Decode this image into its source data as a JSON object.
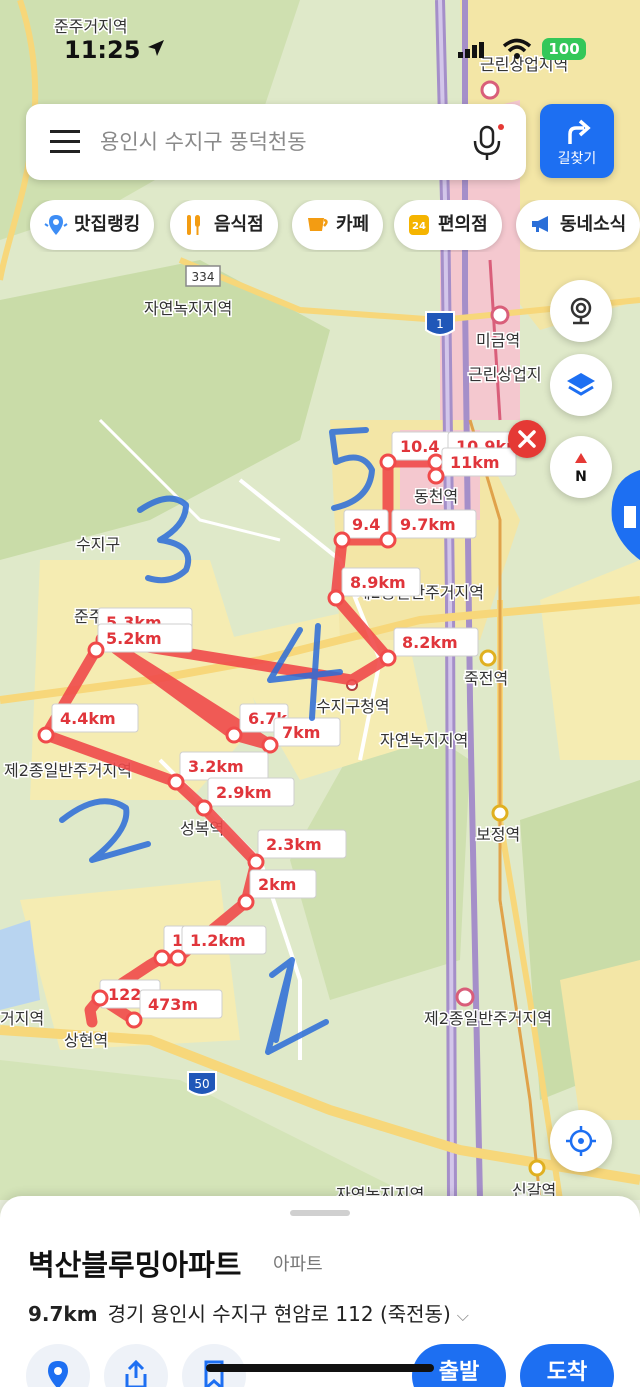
{
  "status_bar": {
    "time": "11:25",
    "battery": "100"
  },
  "search": {
    "placeholder": "용인시 수지구 풍덕천동"
  },
  "directions_button": {
    "label": "길찾기"
  },
  "chips": [
    {
      "label": "맛집랭킹",
      "icon": "ranking-pin-icon"
    },
    {
      "label": "음식점",
      "icon": "fork-knife-icon"
    },
    {
      "label": "카페",
      "icon": "coffee-cup-icon"
    },
    {
      "label": "편의점",
      "icon": "convenience-24-icon"
    },
    {
      "label": "동네소식",
      "icon": "megaphone-icon"
    }
  ],
  "map": {
    "place_labels": {
      "jungju_top": "준주거지역",
      "geunlin_top": "근린상업지역",
      "jayeon_top": "자연녹지지역",
      "mageum_station": "미금역",
      "geunlin_mid": "근린상업지",
      "suji_gu": "수지구",
      "dongcheon_station": "동천역",
      "residential_2_right": "제2종일반주거지역",
      "jungjeon_station": "죽전역",
      "jungju_left": "준주",
      "gucheong_station": "수지구청역",
      "jayeon_right": "자연녹지지역",
      "residential_2_left": "제2종일반주거지역",
      "seongbok_station": "성복역",
      "bojeong_station": "보정역",
      "residential_2_bottom": "제2종일반주거지역",
      "geoji_left": "거지역",
      "sanghyeon_station": "상현역",
      "singal_station": "신갈역",
      "jayeon_bottom": "자연녹지지역"
    },
    "road_shields": {
      "r334": "334",
      "r1": "1",
      "r50": "50"
    },
    "distance_labels": [
      "10.4",
      "10.9km",
      "11km",
      "9.4",
      "9.7km",
      "8.9km",
      "8.2km",
      "5.3km",
      "5.2km",
      "4.4km",
      "6.7k",
      "7km",
      "3.2km",
      "2.9km",
      "2.3km",
      "2km",
      "1",
      "1.2km",
      "122",
      "473m"
    ],
    "handwritten_numbers": [
      "1",
      "2",
      "3",
      "4",
      "5"
    ],
    "route_color": "#f04a4a",
    "label_text_color": "#e0353b"
  },
  "sheet": {
    "title": "벽산블루밍아파트",
    "category": "아파트",
    "distance": "9.7km",
    "address": "경기 용인시 수지구 현암로 112 (죽전동)",
    "depart_label": "출발",
    "arrive_label": "도착"
  }
}
